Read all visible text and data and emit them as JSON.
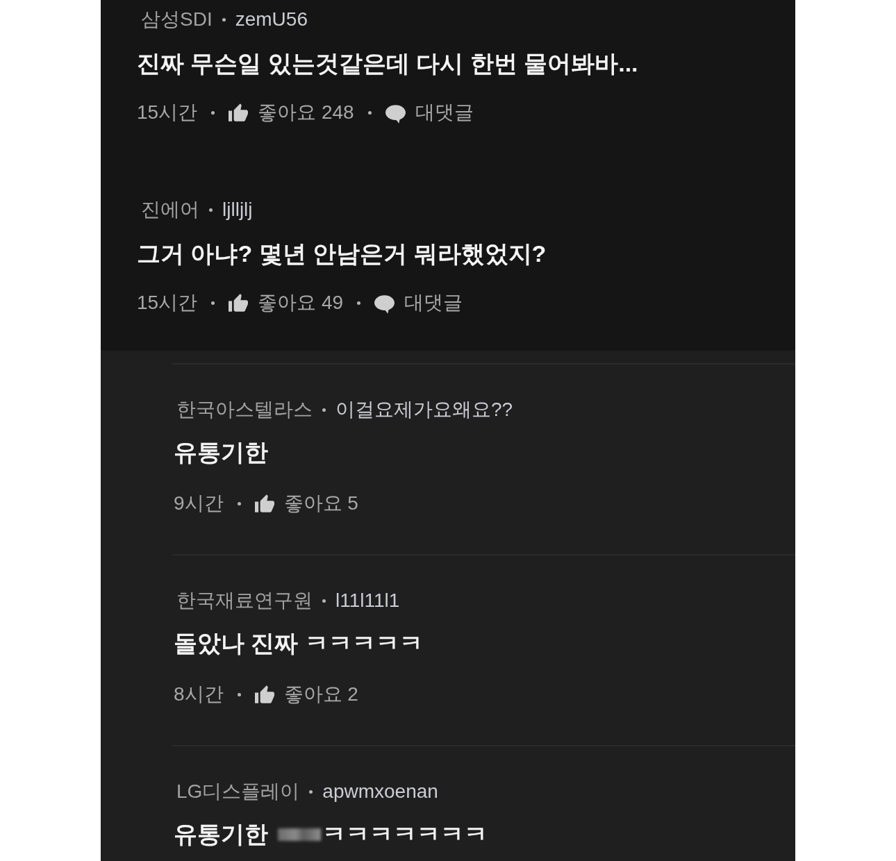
{
  "comments": [
    {
      "author_org": "삼성SDI",
      "username": "zemU56",
      "body": "진짜 무슨일 있는것같은데 다시 한번 물어봐바...",
      "censored": false,
      "time": "15시간",
      "likes": "좋아요 248",
      "reply_label": "대댓글"
    },
    {
      "author_org": "진에어",
      "username": "ljlljlj",
      "body": "그거 아냐? 몇년 안남은거 뭐라했었지?",
      "censored": false,
      "time": "15시간",
      "likes": "좋아요 49",
      "reply_label": "대댓글",
      "replies": [
        {
          "author_org": "한국아스텔라스",
          "username": "이걸요제가요왜요??",
          "body": "유통기한",
          "censored": false,
          "time": "9시간",
          "likes": "좋아요 5"
        },
        {
          "author_org": "한국재료연구원",
          "username": "l11l11l1",
          "body": "돌았나 진짜 ㅋㅋㅋㅋㅋ",
          "censored": false,
          "time": "8시간",
          "likes": "좋아요 2"
        },
        {
          "author_org": "LG디스플레이",
          "username": "apwmxoenan",
          "body": "유통기한",
          "censored": true,
          "body_after": "ㅋㅋㅋㅋㅋㅋㅋ"
        }
      ]
    }
  ]
}
